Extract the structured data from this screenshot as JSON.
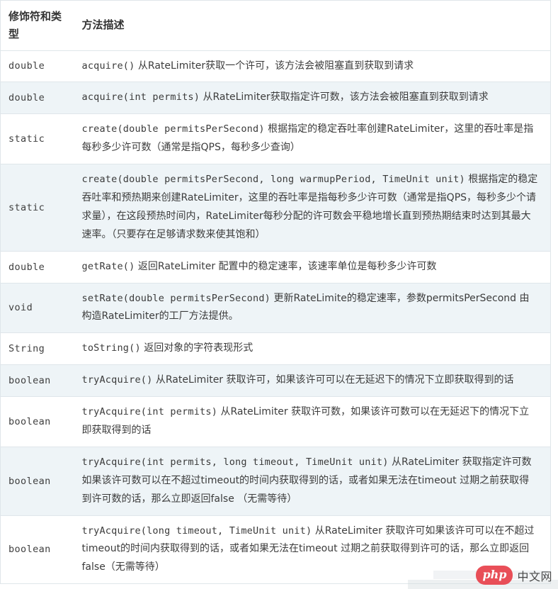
{
  "table": {
    "headers": {
      "type": "修饰符和类型",
      "description": "方法描述"
    },
    "rows": [
      {
        "type": "double",
        "signature": "acquire()",
        "description": " 从RateLimiter获取一个许可，该方法会被阻塞直到获取到请求"
      },
      {
        "type": "double",
        "signature": "acquire(int permits)",
        "description": " 从RateLimiter获取指定许可数，该方法会被阻塞直到获取到请求"
      },
      {
        "type": "static",
        "signature": "create(double permitsPerSecond)",
        "description": " 根据指定的稳定吞吐率创建RateLimiter，这里的吞吐率是指每秒多少许可数（通常是指QPS，每秒多少查询）"
      },
      {
        "type": "static",
        "signature": "create(double permitsPerSecond, long warmupPeriod, TimeUnit unit)",
        "description": " 根据指定的稳定吞吐率和预热期来创建RateLimiter，这里的吞吐率是指每秒多少许可数（通常是指QPS，每秒多少个请求量），在这段预热时间内，RateLimiter每秒分配的许可数会平稳地增长直到预热期结束时达到其最大速率。（只要存在足够请求数来使其饱和）"
      },
      {
        "type": "double",
        "signature": "getRate()",
        "description": " 返回RateLimiter 配置中的稳定速率，该速率单位是每秒多少许可数"
      },
      {
        "type": "void",
        "signature": "setRate(double permitsPerSecond)",
        "description": " 更新RateLimite的稳定速率，参数permitsPerSecond 由构造RateLimiter的工厂方法提供。"
      },
      {
        "type": "String",
        "signature": "toString()",
        "description": " 返回对象的字符表现形式"
      },
      {
        "type": "boolean",
        "signature": "tryAcquire()",
        "description": " 从RateLimiter 获取许可，如果该许可可以在无延迟下的情况下立即获取得到的话"
      },
      {
        "type": "boolean",
        "signature": "tryAcquire(int permits)",
        "description": " 从RateLimiter 获取许可数，如果该许可数可以在无延迟下的情况下立即获取得到的话"
      },
      {
        "type": "boolean",
        "signature": "tryAcquire(int permits, long timeout, TimeUnit unit)",
        "description": " 从RateLimiter 获取指定许可数如果该许可数可以在不超过timeout的时间内获取得到的话，或者如果无法在timeout 过期之前获取得到许可数的话，那么立即返回false （无需等待）"
      },
      {
        "type": "boolean",
        "signature": "tryAcquire(long timeout, TimeUnit unit)",
        "description": " 从RateLimiter 获取许可如果该许可可以在不超过timeout的时间内获取得到的话，或者如果无法在timeout 过期之前获取得到许可的话，那么立即返回false（无需等待）"
      }
    ]
  },
  "watermark": {
    "badge": "php",
    "text": "中文网",
    "badge_color": "#e8414a"
  }
}
